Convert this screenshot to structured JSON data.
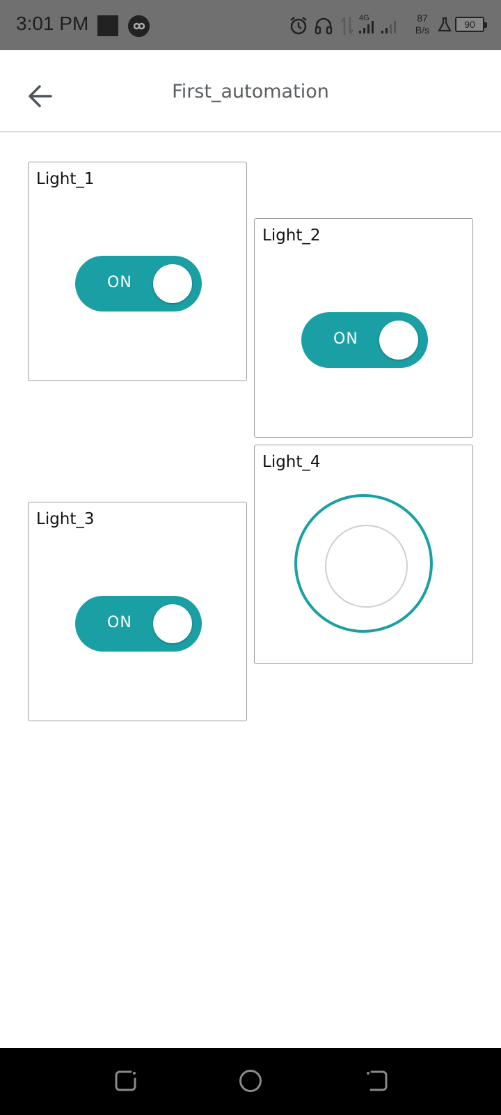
{
  "status_bar": {
    "time": "3:01 PM",
    "network": "4G",
    "speed_value": "87",
    "speed_unit": "B/s",
    "battery": "90"
  },
  "app_bar": {
    "title": "First_automation",
    "back_icon": "arrow-left-icon"
  },
  "widgets": [
    {
      "title": "Light_1",
      "type": "toggle",
      "state_label": "ON",
      "state": true
    },
    {
      "title": "Light_2",
      "type": "toggle",
      "state_label": "ON",
      "state": true
    },
    {
      "title": "Light_3",
      "type": "toggle",
      "state_label": "ON",
      "state": true
    },
    {
      "title": "Light_4",
      "type": "dial"
    }
  ],
  "colors": {
    "accent": "#1aa0a4",
    "status_bar": "#707070",
    "title_text": "#5a5f63"
  },
  "nav_bar": {
    "icons": [
      "recent-apps-icon",
      "home-icon",
      "back-icon"
    ]
  }
}
